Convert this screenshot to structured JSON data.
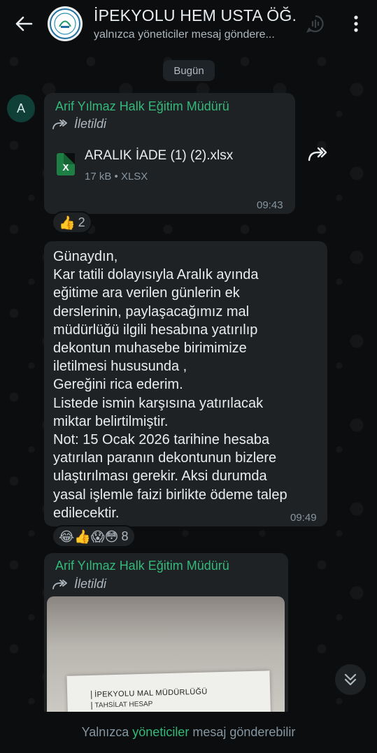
{
  "header": {
    "title": "İPEKYOLU HEM USTA ÖĞ...",
    "subtitle": "yalnızca yöneticiler mesaj göndere...",
    "back_icon": "arrow-left-icon",
    "call_icon": "voice-chat-icon",
    "menu_icon": "more-vertical-icon"
  },
  "date_chip": "Bugün",
  "messages": [
    {
      "sender_initial": "A",
      "sender": "Arif Yılmaz Halk Eğitim Müdürü",
      "forwarded_label": "İletildi",
      "file_name": "ARALIK İADE (1) (2).xlsx",
      "file_meta": "17 kB • XLSX",
      "file_icon_label": "X",
      "time": "09:43",
      "reactions": {
        "emojis": "👍",
        "count": "2"
      }
    },
    {
      "lines": [
        "Günaydın,",
        "Kar tatili dolayısıyla Aralık ayında",
        "eğitime ara verilen günlerin ek",
        "derslerinin, paylaşacağımız mal",
        "müdürlüğü ilgili hesabına yatırılıp",
        "dekontun muhasebe birimimize",
        "iletilmesi hususunda ,",
        "Gereğini rica ederim.",
        "Listede ismin karşısına yatırılacak",
        "miktar belirtilmiştir.",
        "Not: 15 Ocak 2026 tarihine hesaba",
        "yatırılan paranın dekontunun bizlere",
        "ulaştırılması gerekir. Aksi durumda",
        "yasal işlemle faizi birlikte ödeme talep",
        "edilecektir."
      ],
      "time": "09:49",
      "reactions": {
        "emojis": "😂👍😱😳",
        "count": "8"
      }
    },
    {
      "sender": "Arif Yılmaz Halk Eğitim Müdürü",
      "forwarded_label": "İletildi",
      "photo_text_1": "İPEKYOLU MAL MÜDÜRLÜĞÜ",
      "photo_text_2": "TAHSİLAT HESAP"
    }
  ],
  "footer": {
    "before": "Yalnızca",
    "highlight": "yöneticiler",
    "after": "mesaj gönderebilir"
  },
  "colors": {
    "accent": "#33b97a",
    "bubble": "#1f2225",
    "background": "#0b0d0f"
  }
}
